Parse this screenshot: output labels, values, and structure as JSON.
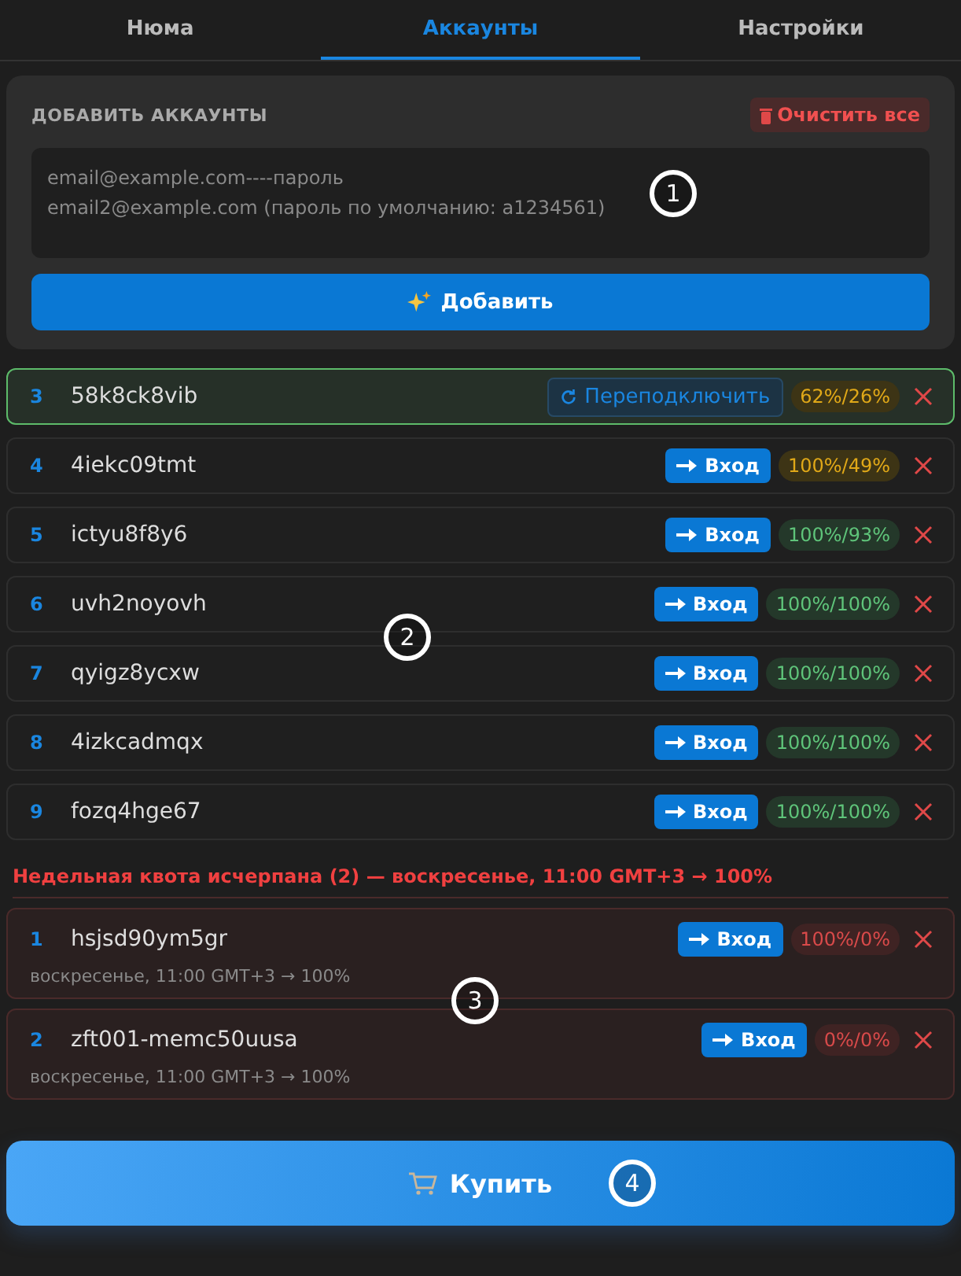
{
  "tabs": [
    {
      "label": "Нюма",
      "selected": false
    },
    {
      "label": "Аккаунты",
      "selected": true
    },
    {
      "label": "Настройки",
      "selected": false
    }
  ],
  "add_panel": {
    "title": "ДОБАВИТЬ АККАУНТЫ",
    "clear_button": "Очистить все",
    "placeholder": "email@example.com----пароль\nemail2@example.com (пароль по умолчанию: a1234561)",
    "add_button": "Добавить",
    "marker": "1"
  },
  "accounts": {
    "marker": "2",
    "items": [
      {
        "index": "3",
        "name": "58k8ck8vib",
        "selected": true,
        "action": {
          "kind": "reconnect",
          "label": "Переподключить"
        },
        "quota": {
          "kind": "warn",
          "text": "62%/26%"
        }
      },
      {
        "index": "4",
        "name": "4iekc09tmt",
        "selected": false,
        "action": {
          "kind": "login",
          "label": "Вход"
        },
        "quota": {
          "kind": "warn",
          "text": "100%/49%"
        }
      },
      {
        "index": "5",
        "name": "ictyu8f8y6",
        "selected": false,
        "action": {
          "kind": "login",
          "label": "Вход"
        },
        "quota": {
          "kind": "ok",
          "text": "100%/93%"
        }
      },
      {
        "index": "6",
        "name": "uvh2noyovh",
        "selected": false,
        "action": {
          "kind": "login",
          "label": "Вход"
        },
        "quota": {
          "kind": "ok",
          "text": "100%/100%"
        }
      },
      {
        "index": "7",
        "name": "qyigz8ycxw",
        "selected": false,
        "action": {
          "kind": "login",
          "label": "Вход"
        },
        "quota": {
          "kind": "ok",
          "text": "100%/100%"
        }
      },
      {
        "index": "8",
        "name": "4izkcadmqx",
        "selected": false,
        "action": {
          "kind": "login",
          "label": "Вход"
        },
        "quota": {
          "kind": "ok",
          "text": "100%/100%"
        }
      },
      {
        "index": "9",
        "name": "fozq4hge67",
        "selected": false,
        "action": {
          "kind": "login",
          "label": "Вход"
        },
        "quota": {
          "kind": "ok",
          "text": "100%/100%"
        }
      }
    ]
  },
  "exhausted": {
    "heading": "Недельная квота исчерпана (2) — воскресенье, 11:00 GMT+3 → 100%",
    "marker": "3",
    "items": [
      {
        "index": "1",
        "name": "hsjsd90ym5gr",
        "action": {
          "kind": "login",
          "label": "Вход"
        },
        "quota": {
          "kind": "bad",
          "text": "100%/0%"
        },
        "reset": "воскресенье, 11:00 GMT+3 → 100%"
      },
      {
        "index": "2",
        "name": "zft001-memc50uusa",
        "action": {
          "kind": "login",
          "label": "Вход"
        },
        "quota": {
          "kind": "bad",
          "text": "0%/0%"
        },
        "reset": "воскресенье, 11:00 GMT+3 → 100%"
      }
    ]
  },
  "buy_button": {
    "label": "Купить",
    "marker": "4"
  }
}
